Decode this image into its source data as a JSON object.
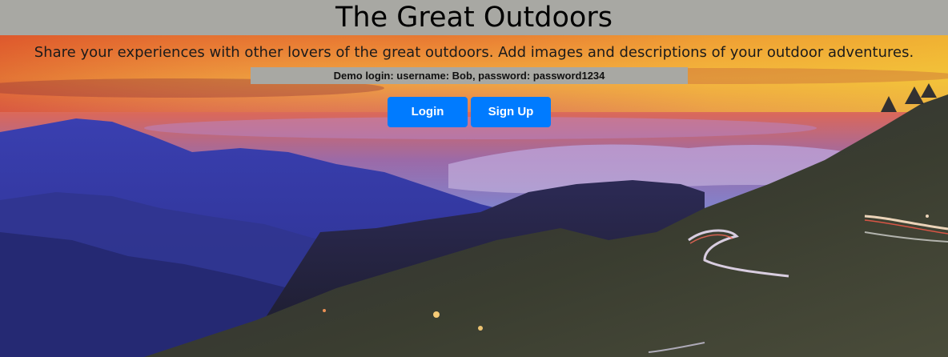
{
  "header": {
    "title": "The Great Outdoors"
  },
  "hero": {
    "tagline": "Share your experiences with other lovers of the great outdoors. Add images and descriptions of your outdoor adventures.",
    "demo_login": "Demo login: username: Bob, password: password1234",
    "background": "mountain-sunset-photo"
  },
  "actions": {
    "login_label": "Login",
    "signup_label": "Sign Up"
  },
  "colors": {
    "title_bar": "#a8a8a3",
    "button": "#007bff",
    "button_text": "#ffffff"
  }
}
